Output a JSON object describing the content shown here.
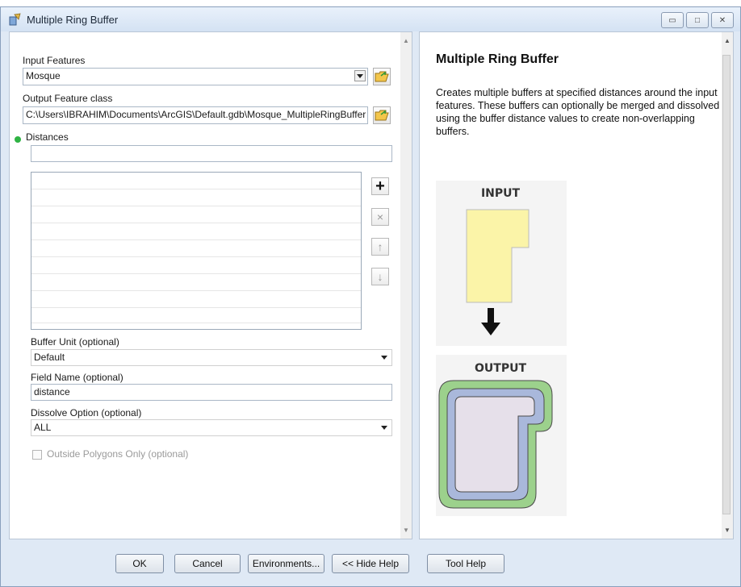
{
  "window": {
    "title": "Multiple Ring Buffer"
  },
  "form": {
    "input_features_label": "Input Features",
    "input_features_value": "Mosque",
    "output_feature_class_label": "Output Feature class",
    "output_feature_class_value": "C:\\Users\\IBRAHIM\\Documents\\ArcGIS\\Default.gdb\\Mosque_MultipleRingBuffer",
    "distances_label": "Distances",
    "distances_value": "",
    "buffer_unit_label": "Buffer Unit (optional)",
    "buffer_unit_value": "Default",
    "field_name_label": "Field Name (optional)",
    "field_name_value": "distance",
    "dissolve_option_label": "Dissolve Option (optional)",
    "dissolve_option_value": "ALL",
    "outside_polygons_label": "Outside Polygons Only (optional)"
  },
  "list_buttons": {
    "add": "+",
    "remove": "×",
    "up": "↑",
    "down": "↓"
  },
  "help": {
    "title": "Multiple Ring Buffer",
    "description": "Creates multiple buffers at specified distances around the input features. These buffers can optionally be merged and dissolved using the buffer distance values to create non-overlapping buffers.",
    "diagram_input_label": "INPUT",
    "diagram_output_label": "OUTPUT"
  },
  "buttons": {
    "ok": "OK",
    "cancel": "Cancel",
    "environments": "Environments...",
    "hide_help": "<< Hide Help",
    "tool_help": "Tool Help"
  },
  "colors": {
    "input_fill": "#fbf4a8",
    "ring_outer": "#9cd18c",
    "ring_middle": "#a9b8db",
    "ring_inner": "#e6e0ea",
    "required_dot": "#2fb344"
  }
}
